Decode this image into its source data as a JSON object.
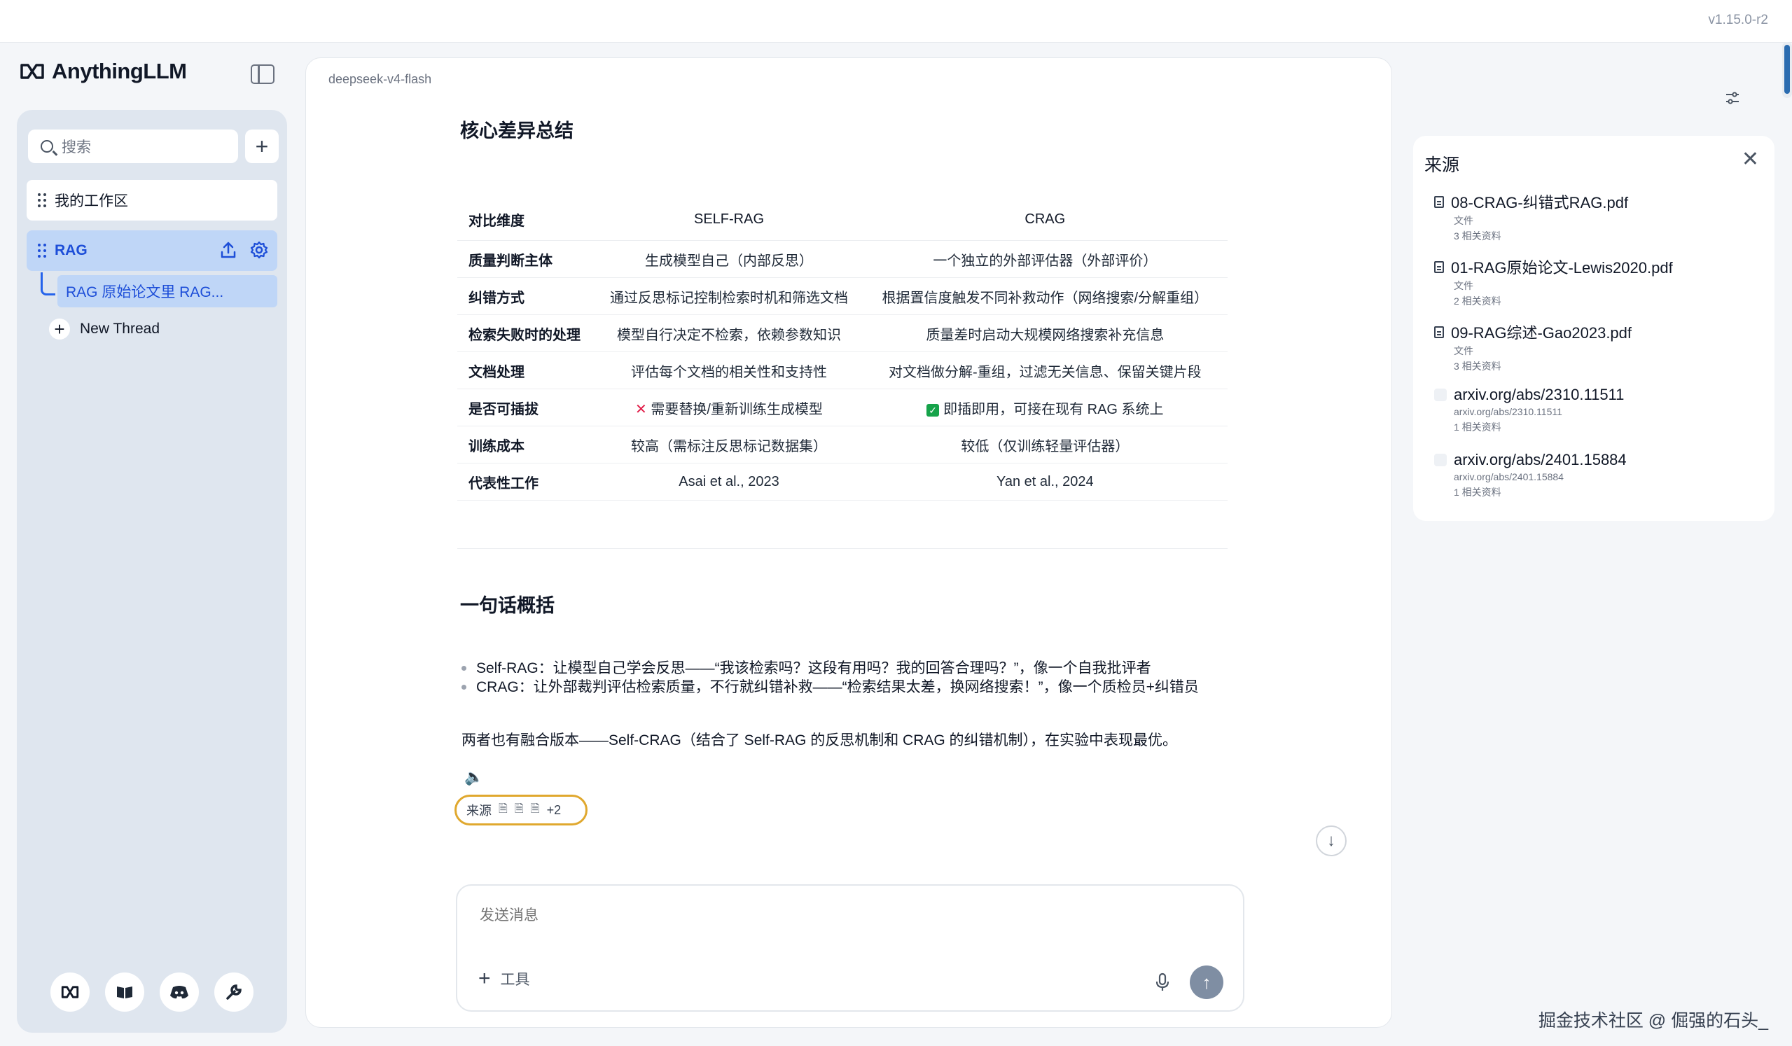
{
  "app": {
    "version": "v1.15.0-r2",
    "brand": "AnythingLLM"
  },
  "sidebar": {
    "search_label": "搜索",
    "workspaces": [
      {
        "label": "我的工作区"
      },
      {
        "label": "RAG"
      }
    ],
    "active_thread": "RAG 原始论文里 RAG...",
    "new_thread": "New Thread"
  },
  "chat": {
    "model": "deepseek-v4-flash",
    "heading1": "核心差异总结",
    "table": {
      "headers": [
        "对比维度",
        "SELF-RAG",
        "CRAG"
      ],
      "rows": [
        [
          "质量判断主体",
          "生成模型自己（内部反思）",
          "一个独立的外部评估器（外部评价）"
        ],
        [
          "纠错方式",
          "通过反思标记控制检索时机和筛选文档",
          "根据置信度触发不同补救动作（网络搜索/分解重组）"
        ],
        [
          "检索失败时的处理",
          "模型自行决定不检索，依赖参数知识",
          "质量差时启动大规模网络搜索补充信息"
        ],
        [
          "文档处理",
          "评估每个文档的相关性和支持性",
          "对文档做分解-重组，过滤无关信息、保留关键片段"
        ],
        [
          "是否可插拔",
          "需要替换/重新训练生成模型",
          "即插即用，可接在现有 RAG 系统上"
        ],
        [
          "训练成本",
          "较高（需标注反思标记数据集）",
          "较低（仅训练轻量评估器）"
        ],
        [
          "代表性工作",
          "Asai et al., 2023",
          "Yan et al., 2024"
        ]
      ]
    },
    "heading2": "一句话概括",
    "bullets": [
      "Self-RAG：让模型自己学会反思——“我该检索吗？这段有用吗？我的回答合理吗？”，像一个自我批评者",
      "CRAG：让外部裁判评估检索质量，不行就纠错补救——“检索结果太差，换网络搜索！”，像一个质检员+纠错员"
    ],
    "paragraph": "两者也有融合版本——Self-CRAG（结合了 Self-RAG 的反思机制和 CRAG 的纠错机制），在实验中表现最优。",
    "sources_label": "来源",
    "sources_more": "+2",
    "composer_placeholder": "发送消息",
    "tools_label": "工具"
  },
  "sources_panel": {
    "title": "来源",
    "items": [
      {
        "name": "08-CRAG-纠错式RAG.pdf",
        "type": "文件",
        "refs": "3 相关资料",
        "icon": "doc-icon"
      },
      {
        "name": "01-RAG原始论文-Lewis2020.pdf",
        "type": "文件",
        "refs": "2 相关资料",
        "icon": "doc-icon"
      },
      {
        "name": "09-RAG综述-Gao2023.pdf",
        "type": "文件",
        "refs": "3 相关资料",
        "icon": "doc-icon"
      },
      {
        "name": "arxiv.org/abs/2310.11511",
        "type": "arxiv.org/abs/2310.11511",
        "refs": "1 相关资料",
        "icon": "web-icon"
      },
      {
        "name": "arxiv.org/abs/2401.15884",
        "type": "arxiv.org/abs/2401.15884",
        "refs": "1 相关资料",
        "icon": "web-icon"
      }
    ]
  },
  "watermark": "掘金技术社区 @ 倔强的石头_",
  "colors": {
    "accent": "#1d4ed8",
    "active_bg": "#bfd6f7",
    "pill_border": "#e0a82e",
    "send_bg": "#7f8ea3"
  }
}
